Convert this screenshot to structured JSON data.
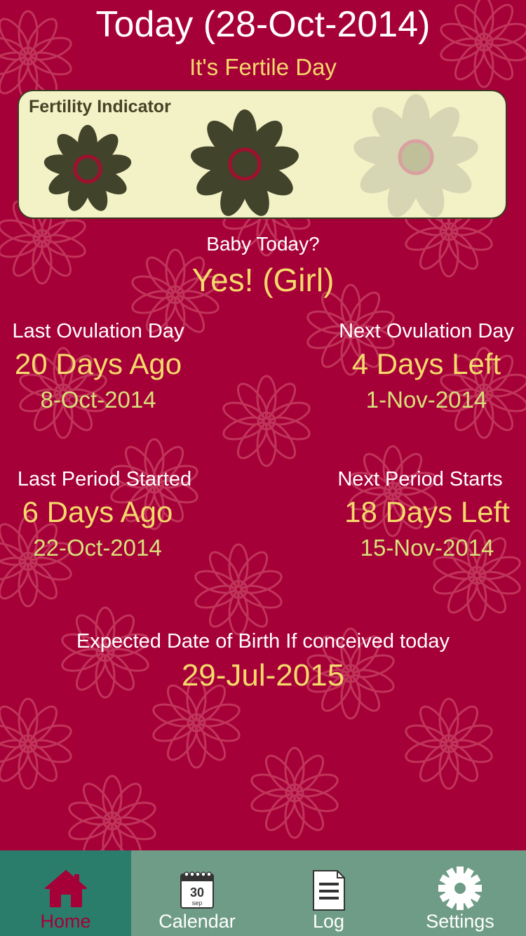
{
  "header": {
    "title": "Today (28-Oct-2014)",
    "subtitle": "It's Fertile Day"
  },
  "fertility": {
    "label": "Fertility Indicator",
    "flowers": [
      "active",
      "active",
      "inactive"
    ],
    "level": "2 of 3"
  },
  "baby": {
    "question": "Baby Today?",
    "answer": "Yes! (Girl)"
  },
  "stats": {
    "last_ovulation": {
      "label": "Last Ovulation Day",
      "value": "20 Days Ago",
      "date": "8-Oct-2014"
    },
    "next_ovulation": {
      "label": "Next Ovulation Day",
      "value": "4 Days Left",
      "date": "1-Nov-2014"
    },
    "last_period": {
      "label": "Last Period Started",
      "value": "6 Days Ago",
      "date": "22-Oct-2014"
    },
    "next_period": {
      "label": "Next Period Starts",
      "value": "18 Days Left",
      "date": "15-Nov-2014"
    }
  },
  "birth": {
    "label": "Expected Date of Birth If conceived today",
    "date": "29-Jul-2015"
  },
  "tabbar": {
    "tabs": [
      {
        "label": "Home",
        "icon": "home-icon",
        "active": true
      },
      {
        "label": "Calendar",
        "icon": "calendar-icon",
        "active": false
      },
      {
        "label": "Log",
        "icon": "log-icon",
        "active": false
      },
      {
        "label": "Settings",
        "icon": "gear-icon",
        "active": false
      }
    ],
    "calendar_icon_day": "30",
    "calendar_icon_month": "sep"
  },
  "colors": {
    "background": "#a60038",
    "accent_yellow": "#f5d96b",
    "tab_bar": "#6f9c86",
    "tab_active": "#2a7d6b"
  }
}
